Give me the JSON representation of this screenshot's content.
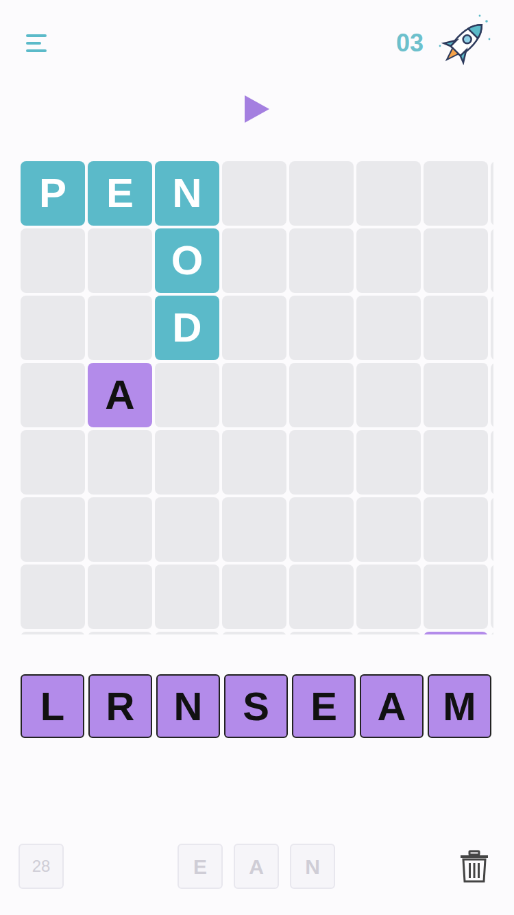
{
  "header": {
    "score": "03"
  },
  "grid": {
    "rows": [
      [
        {
          "letter": "P",
          "kind": "word"
        },
        {
          "letter": "E",
          "kind": "word"
        },
        {
          "letter": "N",
          "kind": "word"
        },
        {
          "letter": "",
          "kind": "empty"
        },
        {
          "letter": "",
          "kind": "empty"
        },
        {
          "letter": "",
          "kind": "empty"
        },
        {
          "letter": "",
          "kind": "empty"
        },
        {
          "letter": "",
          "kind": "empty"
        }
      ],
      [
        {
          "letter": "",
          "kind": "empty"
        },
        {
          "letter": "",
          "kind": "empty"
        },
        {
          "letter": "O",
          "kind": "word"
        },
        {
          "letter": "",
          "kind": "empty"
        },
        {
          "letter": "",
          "kind": "empty"
        },
        {
          "letter": "",
          "kind": "empty"
        },
        {
          "letter": "",
          "kind": "empty"
        },
        {
          "letter": "",
          "kind": "empty"
        }
      ],
      [
        {
          "letter": "",
          "kind": "empty"
        },
        {
          "letter": "",
          "kind": "empty"
        },
        {
          "letter": "D",
          "kind": "word"
        },
        {
          "letter": "",
          "kind": "empty"
        },
        {
          "letter": "",
          "kind": "empty"
        },
        {
          "letter": "",
          "kind": "empty"
        },
        {
          "letter": "",
          "kind": "empty"
        },
        {
          "letter": "",
          "kind": "empty"
        }
      ],
      [
        {
          "letter": "",
          "kind": "empty"
        },
        {
          "letter": "A",
          "kind": "placed"
        },
        {
          "letter": "",
          "kind": "empty"
        },
        {
          "letter": "",
          "kind": "empty"
        },
        {
          "letter": "",
          "kind": "empty"
        },
        {
          "letter": "",
          "kind": "empty"
        },
        {
          "letter": "",
          "kind": "empty"
        },
        {
          "letter": "",
          "kind": "empty"
        }
      ],
      [
        {
          "letter": "",
          "kind": "empty"
        },
        {
          "letter": "",
          "kind": "empty"
        },
        {
          "letter": "",
          "kind": "empty"
        },
        {
          "letter": "",
          "kind": "empty"
        },
        {
          "letter": "",
          "kind": "empty"
        },
        {
          "letter": "",
          "kind": "empty"
        },
        {
          "letter": "",
          "kind": "empty"
        },
        {
          "letter": "",
          "kind": "empty"
        }
      ],
      [
        {
          "letter": "",
          "kind": "empty"
        },
        {
          "letter": "",
          "kind": "empty"
        },
        {
          "letter": "",
          "kind": "empty"
        },
        {
          "letter": "",
          "kind": "empty"
        },
        {
          "letter": "",
          "kind": "empty"
        },
        {
          "letter": "",
          "kind": "empty"
        },
        {
          "letter": "",
          "kind": "empty"
        },
        {
          "letter": "",
          "kind": "empty"
        }
      ],
      [
        {
          "letter": "",
          "kind": "empty"
        },
        {
          "letter": "",
          "kind": "empty"
        },
        {
          "letter": "",
          "kind": "empty"
        },
        {
          "letter": "",
          "kind": "empty"
        },
        {
          "letter": "",
          "kind": "empty"
        },
        {
          "letter": "",
          "kind": "empty"
        },
        {
          "letter": "",
          "kind": "empty"
        },
        {
          "letter": "",
          "kind": "empty"
        }
      ],
      [
        {
          "letter": "",
          "kind": "empty"
        },
        {
          "letter": "",
          "kind": "empty"
        },
        {
          "letter": "",
          "kind": "empty"
        },
        {
          "letter": "",
          "kind": "empty"
        },
        {
          "letter": "",
          "kind": "empty"
        },
        {
          "letter": "",
          "kind": "empty"
        },
        {
          "letter": "",
          "kind": "placed"
        },
        {
          "letter": "",
          "kind": "empty"
        }
      ]
    ]
  },
  "rack": [
    {
      "letter": "L"
    },
    {
      "letter": "R"
    },
    {
      "letter": "N"
    },
    {
      "letter": "S"
    },
    {
      "letter": "E"
    },
    {
      "letter": "A"
    },
    {
      "letter": "M"
    }
  ],
  "footer": {
    "tiles_left": "28",
    "last_word": [
      "E",
      "A",
      "N"
    ]
  }
}
